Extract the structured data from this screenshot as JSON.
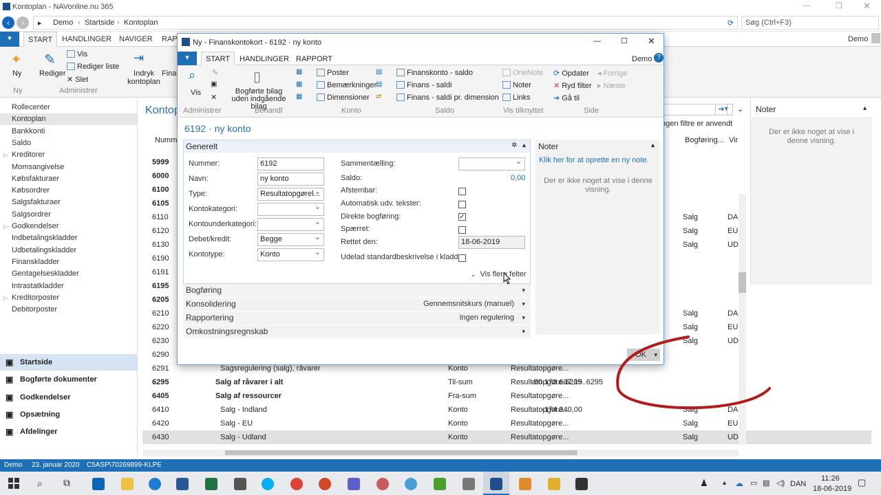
{
  "window": {
    "title": "Kontoplan - NAVonline.nu 365"
  },
  "nav": {
    "crumbs": [
      "Demo",
      "Startside",
      "Kontoplan"
    ],
    "search_placeholder": "Søg (Ctrl+F3)"
  },
  "ribbon": {
    "tabs": [
      "START",
      "HANDLINGER",
      "NAVIGER",
      "RAPP"
    ],
    "user": "Demo",
    "buttons": {
      "ny": "Ny",
      "rediger": "Rediger",
      "vis": "Vis",
      "rediger_liste": "Rediger liste",
      "slet": "Slet",
      "indryk": "Indryk kontoplan",
      "finan": "Finan"
    },
    "groups": {
      "ny": "Ny",
      "administrer": "Administrer"
    }
  },
  "sidebar": {
    "items": [
      "Rollecenter",
      "Kontoplan",
      "Bankkonti",
      "Saldo",
      "Kreditorer",
      "Momsangivelse",
      "Købsfakturaer",
      "Købsordrer",
      "Salgsfakturaer",
      "Salgsordrer",
      "Godkendelser",
      "Indbetalingskladder",
      "Udbetalingskladder",
      "Finanskladder",
      "Gentagelseskladder",
      "Intrastatkladder",
      "Kreditorposter",
      "Debitorposter"
    ],
    "bottom": [
      "Startside",
      "Bogførte dokumenter",
      "Godkendelser",
      "Opsætning",
      "Afdelinger"
    ]
  },
  "page": {
    "title": "Kontop",
    "filter_note": "ngen filtre er anvendt",
    "col_nummer": "Numm",
    "col_bogforing": "Bogføring...",
    "col_vir": "Vir"
  },
  "rows": [
    {
      "no": "5999",
      "bold": true,
      "name": "",
      "amount": "",
      "type": "",
      "ktype": "",
      "tot": "",
      "bog": "",
      "v": ""
    },
    {
      "no": "6000",
      "bold": true,
      "name": "",
      "amount": "",
      "type": "",
      "ktype": "",
      "tot": "",
      "bog": "",
      "v": ""
    },
    {
      "no": "6100",
      "bold": true,
      "name": "",
      "amount": "",
      "type": "",
      "ktype": "",
      "tot": "",
      "bog": "",
      "v": ""
    },
    {
      "no": "6105",
      "bold": true,
      "name": "",
      "amount": "",
      "type": "",
      "ktype": "",
      "tot": "",
      "bog": "",
      "v": ""
    },
    {
      "no": "6110",
      "bold": false,
      "name": "",
      "amount": "",
      "type": "",
      "ktype": "",
      "tot": "",
      "bog": "Salg",
      "v": "DA"
    },
    {
      "no": "6120",
      "bold": false,
      "name": "",
      "amount": "",
      "type": "",
      "ktype": "",
      "tot": "",
      "bog": "Salg",
      "v": "EU"
    },
    {
      "no": "6130",
      "bold": false,
      "name": "",
      "amount": "",
      "type": "",
      "ktype": "",
      "tot": "",
      "bog": "Salg",
      "v": "UD"
    },
    {
      "no": "6190",
      "bold": false,
      "name": "",
      "amount": "",
      "type": "",
      "ktype": "",
      "tot": "",
      "bog": "",
      "v": ""
    },
    {
      "no": "6191",
      "bold": false,
      "name": "",
      "amount": "",
      "type": "",
      "ktype": "",
      "tot": "",
      "bog": "",
      "v": ""
    },
    {
      "no": "6195",
      "bold": true,
      "name": "",
      "amount": "",
      "type": "",
      "ktype": "",
      "tot": "",
      "bog": "",
      "v": ""
    },
    {
      "no": "6205",
      "bold": true,
      "name": "",
      "amount": "",
      "type": "",
      "ktype": "",
      "tot": "",
      "bog": "",
      "v": ""
    },
    {
      "no": "6210",
      "bold": false,
      "name": "",
      "amount": "",
      "type": "",
      "ktype": "",
      "tot": "",
      "bog": "Salg",
      "v": "DA"
    },
    {
      "no": "6220",
      "bold": false,
      "name": "",
      "amount": "",
      "type": "",
      "ktype": "",
      "tot": "",
      "bog": "Salg",
      "v": "EU"
    },
    {
      "no": "6230",
      "bold": false,
      "name": "",
      "amount": "",
      "type": "",
      "ktype": "",
      "tot": "",
      "bog": "Salg",
      "v": "UD"
    },
    {
      "no": "6290",
      "bold": false,
      "name": "",
      "amount": "",
      "type": "",
      "ktype": "",
      "tot": "",
      "bog": "",
      "v": ""
    },
    {
      "no": "6291",
      "bold": false,
      "name": "Sagsregulering (salg), råvarer",
      "amount": "",
      "type": "Konto",
      "ktype": "Resultatopgøre...",
      "tot": "",
      "bog": "",
      "v": ""
    },
    {
      "no": "6295",
      "bold": true,
      "name": "Salg af råvarer i alt",
      "amount": "-50.173.607,19",
      "type": "Til-sum",
      "ktype": "Resultatopgøre...",
      "tot": "6205..6295",
      "bog": "",
      "v": ""
    },
    {
      "no": "6405",
      "bold": true,
      "name": "Salg af ressourcer",
      "amount": "",
      "type": "Fra-sum",
      "ktype": "Resultatopgøre...",
      "tot": "",
      "bog": "",
      "v": ""
    },
    {
      "no": "6410",
      "bold": false,
      "name": "Salg - Indland",
      "amount": "-174.340,00",
      "type": "Konto",
      "ktype": "Resultatopgøre...",
      "tot": "",
      "bog": "Salg",
      "v": "DA"
    },
    {
      "no": "6420",
      "bold": false,
      "name": "Salg - EU",
      "amount": "",
      "type": "Konto",
      "ktype": "Resultatopgøre...",
      "tot": "",
      "bog": "Salg",
      "v": "EU"
    },
    {
      "no": "6430",
      "bold": false,
      "name": "Salg - Udland",
      "amount": "",
      "type": "Konto",
      "ktype": "Resultatopgøre...",
      "tot": "",
      "bog": "Salg",
      "v": "UD"
    }
  ],
  "notes_panel": {
    "title": "Noter",
    "empty": "Der er ikke noget at vise i denne visning."
  },
  "status": {
    "company": "Demo",
    "date": "23. januar 2020",
    "server": "C5ASP\\70269899-KLPE"
  },
  "taskbar": {
    "lang": "DAN",
    "time": "11:26",
    "date": "18-06-2019"
  },
  "dialog": {
    "title": "Ny - Finanskontokort - 6192 · ny konto",
    "tabs": [
      "START",
      "HANDLINGER",
      "RAPPORT"
    ],
    "user": "Demo",
    "ribbon": {
      "vis": "Vis",
      "bogforte": "Bogførte bilag uden indgående bilag",
      "poster": "Poster",
      "bemaerkninger": "Bemærkninger",
      "dimensioner": "Dimensioner",
      "finanskonto_saldo": "Finanskonto - saldo",
      "finans_saldi": "Finans - saldi",
      "finans_saldi_dim": "Finans - saldi pr. dimension",
      "onenote": "OneNote",
      "noter": "Noter",
      "links": "Links",
      "opdater": "Opdater",
      "ryd_filter": "Ryd filter",
      "ga_til": "Gå til",
      "forrige": "Forrige",
      "naeste": "Næste",
      "groups": [
        "Administrer",
        "Behandl",
        "Konto",
        "Saldo",
        "Vis tilknyttet",
        "Side"
      ]
    },
    "heading": "6192 · ny konto",
    "general": {
      "title": "Generelt",
      "labels": {
        "nummer": "Nummer:",
        "navn": "Navn:",
        "type": "Type:",
        "kontokategori": "Kontokategori:",
        "kontounderkategori": "Kontounderkategori:",
        "debet": "Debet/kredit:",
        "kontotype": "Kontotype:",
        "sammentaelling": "Sammentælling:",
        "saldo": "Saldo:",
        "afstembar": "Afstembar:",
        "autotekst": "Automatisk udv. tekster:",
        "direkte": "Direkte bogføring:",
        "spaerret": "Spærret:",
        "rettet": "Rettet den:",
        "udelad": "Udelad standardbeskrivelse i kladde:"
      },
      "values": {
        "nummer": "6192",
        "navn": "ny konto",
        "type": "Resultatopgørel...",
        "debet": "Begge",
        "kontotype": "Konto",
        "saldo": "0,00",
        "rettet": "18-06-2019"
      },
      "checks": {
        "afstembar": false,
        "autotekst": false,
        "direkte": true,
        "spaerret": false,
        "udelad": false
      },
      "more": "Vis flere felter"
    },
    "sections": [
      {
        "title": "Bogføring",
        "right": ""
      },
      {
        "title": "Konsolidering",
        "right": "Gennemsnitskurs (manuel)"
      },
      {
        "title": "Rapportering",
        "right": "Ingen regulering"
      },
      {
        "title": "Omkostningsregnskab",
        "right": ""
      }
    ],
    "notes": {
      "title": "Noter",
      "link": "Klik her for at oprette en ny note.",
      "empty": "Der er ikke noget at vise i denne visning."
    },
    "ok": "OK"
  }
}
